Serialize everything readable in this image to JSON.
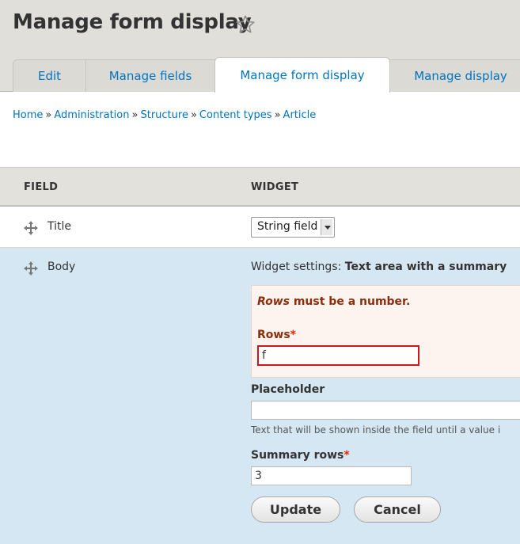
{
  "header": {
    "title": "Manage form display",
    "star_icon": "star-outline-icon"
  },
  "tabs": [
    {
      "label": "Edit",
      "active": false
    },
    {
      "label": "Manage fields",
      "active": false
    },
    {
      "label": "Manage form display",
      "active": true
    },
    {
      "label": "Manage display",
      "active": false
    }
  ],
  "breadcrumb": {
    "items": [
      "Home",
      "Administration",
      "Structure",
      "Content types",
      "Article"
    ],
    "separator": "»"
  },
  "table": {
    "columns": [
      "FIELD",
      "WIDGET"
    ],
    "rows": [
      {
        "field": "Title",
        "widget": "String field"
      },
      {
        "field": "Body"
      }
    ]
  },
  "widget_settings": {
    "prefix": "Widget settings:",
    "name": "Text area with a summary",
    "error": {
      "field": "Rows",
      "message": "must be a number."
    },
    "rows": {
      "label": "Rows",
      "required": "*",
      "value": "f"
    },
    "placeholder": {
      "label": "Placeholder",
      "value": "",
      "help": "Text that will be shown inside the field until a value i"
    },
    "summary_rows": {
      "label": "Summary rows",
      "required": "*",
      "value": "3"
    },
    "buttons": {
      "update": "Update",
      "cancel": "Cancel"
    }
  },
  "colors": {
    "link": "#0074bd",
    "error_text": "#8c2e0b",
    "error_border": "#d0151b",
    "row_highlight": "#d5e7f2",
    "header_bg": "#e0dfd9"
  }
}
